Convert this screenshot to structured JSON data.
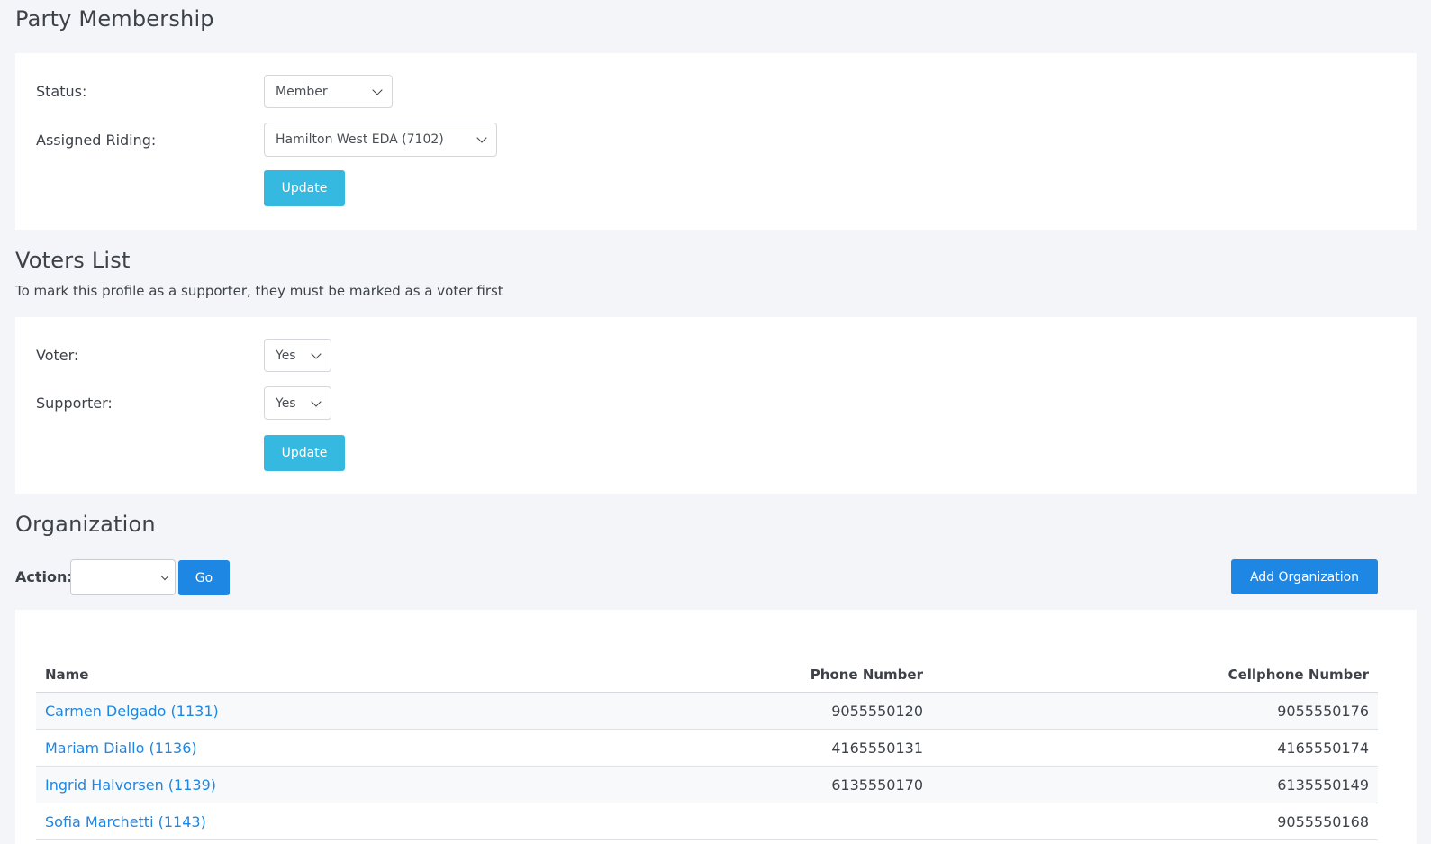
{
  "party_membership": {
    "title": "Party Membership",
    "status_label": "Status:",
    "status_value": "Member",
    "riding_label": "Assigned Riding:",
    "riding_value": "Hamilton West EDA (7102)",
    "update_label": "Update"
  },
  "voters_list": {
    "title": "Voters List",
    "subtitle": "To mark this profile as a supporter, they must be marked as a voter first",
    "voter_label": "Voter:",
    "voter_value": "Yes",
    "supporter_label": "Supporter:",
    "supporter_value": "Yes",
    "update_label": "Update"
  },
  "organization": {
    "title": "Organization",
    "action_label": "Action:",
    "action_value": "",
    "go_label": "Go",
    "add_label": "Add Organization",
    "columns": [
      "Name",
      "Phone Number",
      "Cellphone Number"
    ],
    "rows": [
      {
        "name": "Carmen Delgado (1131)",
        "phone": "9055550120",
        "cell": "9055550176"
      },
      {
        "name": "Mariam Diallo (1136)",
        "phone": "4165550131",
        "cell": "4165550174"
      },
      {
        "name": "Ingrid Halvorsen (1139)",
        "phone": "6135550170",
        "cell": "6135550149"
      },
      {
        "name": "Sofia Marchetti (1143)",
        "phone": "",
        "cell": "9055550168"
      }
    ]
  }
}
